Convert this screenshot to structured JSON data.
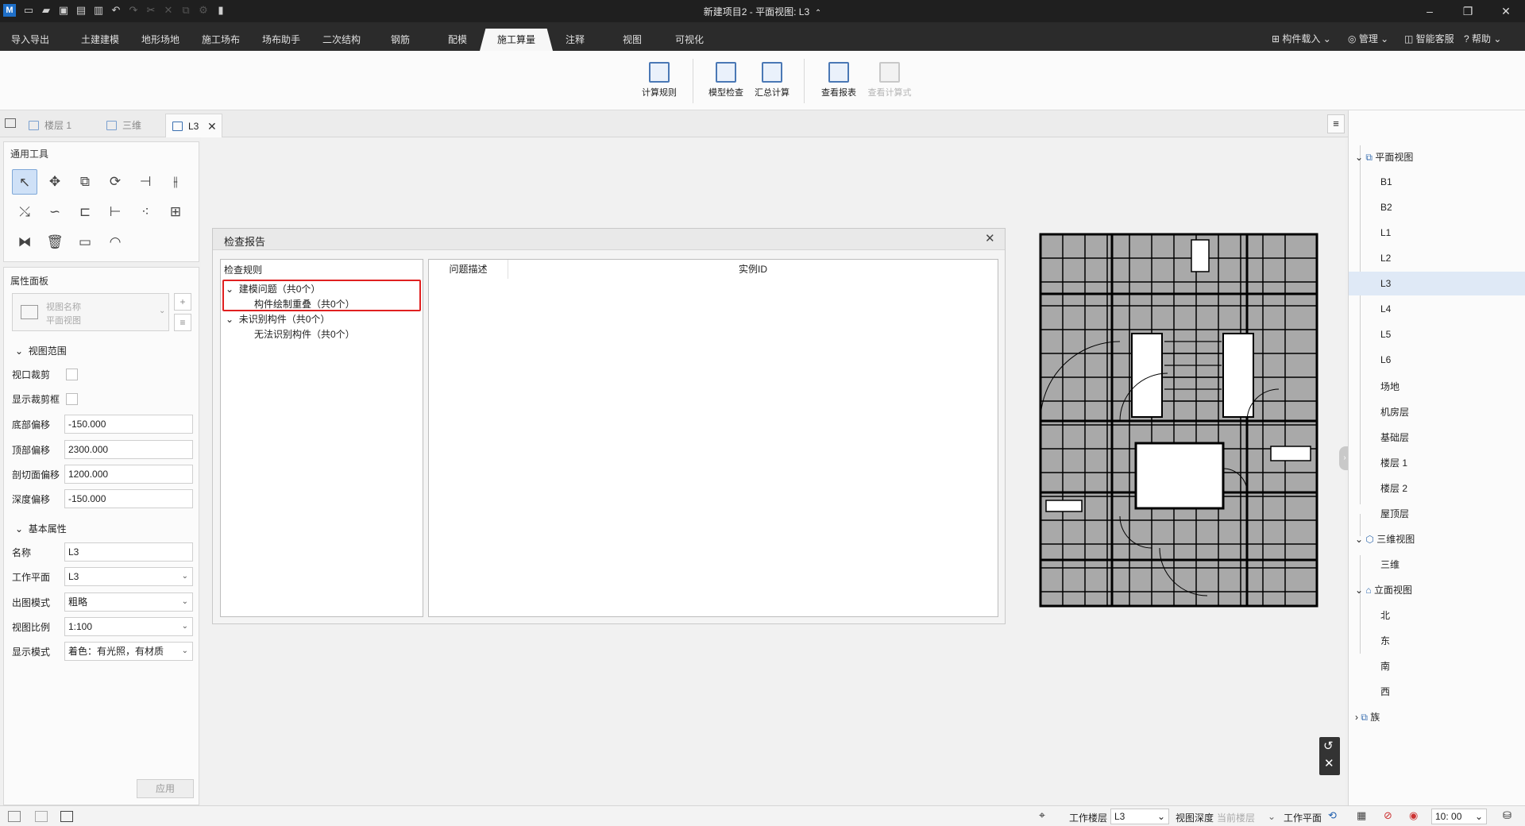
{
  "window": {
    "title": "新建项目2 - 平面视图: L3",
    "title_suffix": "⌃"
  },
  "menu": {
    "tabs": [
      "导入导出",
      "土建建模",
      "地形场地",
      "施工场布",
      "场布助手",
      "二次结构",
      "钢筋",
      "配模",
      "施工算量",
      "注释",
      "视图",
      "可视化"
    ],
    "active_tab": "施工算量",
    "right": {
      "component_load": "构件载入",
      "manage": "管理",
      "service": "智能客服",
      "help": "帮助"
    }
  },
  "ribbon": {
    "buttons": [
      {
        "label": "计算规则",
        "enabled": true
      },
      {
        "label": "模型检查",
        "enabled": true
      },
      {
        "label": "汇总计算",
        "enabled": true
      },
      {
        "label": "查看报表",
        "enabled": true
      },
      {
        "label": "查看计算式",
        "enabled": false
      }
    ]
  },
  "doc_tabs": [
    {
      "label": "楼层 1",
      "active": false
    },
    {
      "label": "三维",
      "active": false
    },
    {
      "label": "L3",
      "active": true,
      "close": "✕"
    }
  ],
  "tools_panel": {
    "title": "通用工具"
  },
  "props_panel": {
    "title": "属性面板",
    "view_name_placeholder": "视图名称",
    "view_type_placeholder": "平面视图",
    "section_view_range": "视图范围",
    "section_basic": "基本属性",
    "labels": {
      "crop": "视口裁剪",
      "show_crop": "显示裁剪框",
      "bottom_offset": "底部偏移",
      "top_offset": "顶部偏移",
      "cut_offset": "剖切面偏移",
      "depth_offset": "深度偏移",
      "name": "名称",
      "work_plane": "工作平面",
      "drawing_mode": "出图模式",
      "view_scale": "视图比例",
      "display_mode": "显示模式"
    },
    "values": {
      "bottom_offset": "-150.000",
      "top_offset": "2300.000",
      "cut_offset": "1200.000",
      "depth_offset": "-150.000",
      "name": "L3",
      "work_plane": "L3",
      "drawing_mode": "粗略",
      "view_scale": "1:100",
      "display_mode": "着色：有光照，有材质"
    },
    "apply": "应用"
  },
  "dialog": {
    "title": "检查报告",
    "tree_header": "检查规则",
    "tree": [
      {
        "label": "建模问题（共0个）",
        "child": "构件绘制重叠（共0个）"
      },
      {
        "label": "未识别构件（共0个）",
        "child": "无法识别构件（共0个）"
      }
    ],
    "columns": [
      "问题描述",
      "实例ID"
    ],
    "highlight_color": "#e02020"
  },
  "project_tree": {
    "groups": [
      {
        "label": "平面视图",
        "icon": "plan-view-icon",
        "children": [
          "B1",
          "B2",
          "L1",
          "L2",
          "L3",
          "L4",
          "L5",
          "L6",
          "场地",
          "机房层",
          "基础层",
          "楼层 1",
          "楼层 2",
          "屋顶层"
        ]
      },
      {
        "label": "三维视图",
        "icon": "cube-icon",
        "children": [
          "三维"
        ]
      },
      {
        "label": "立面视图",
        "icon": "elevation-icon",
        "children": [
          "北",
          "东",
          "南",
          "西"
        ]
      },
      {
        "label": "族",
        "icon": "family-icon",
        "children": []
      }
    ],
    "selected": "L3"
  },
  "status": {
    "work_floor_label": "工作楼层",
    "work_floor_value": "L3",
    "view_depth_label": "视图深度",
    "view_depth_value": "当前楼层",
    "work_plane_label": "工作平面",
    "time": "10: 00"
  },
  "colors": {
    "accent": "#1f5fae",
    "menubar": "#2b2b2b",
    "titlebar": "#1f1f1f"
  }
}
